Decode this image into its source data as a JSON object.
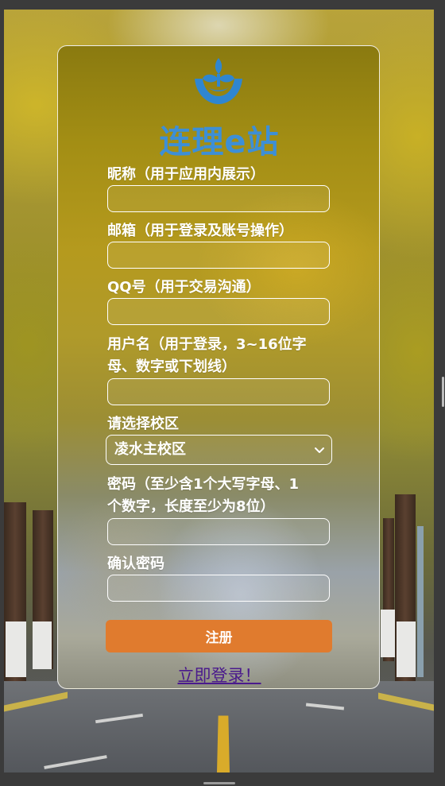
{
  "brand": {
    "name": "连理e站",
    "color": "#3d8fd6"
  },
  "form": {
    "nickname_label": "昵称（用于应用内展示）",
    "email_label": "邮箱（用于登录及账号操作）",
    "qq_label": "QQ号（用于交易沟通）",
    "username_label_line1": "用户名（用于登录，3~16位字",
    "username_label_line2": "母、数字或下划线）",
    "campus_label": "请选择校区",
    "campus_selected": "凌水主校区",
    "password_label_line1": "密码（至少含1个大写字母、1",
    "password_label_line2": "个数字，长度至少为8位）",
    "confirm_label": "确认密码",
    "nickname_value": "",
    "email_value": "",
    "qq_value": "",
    "username_value": "",
    "password_value": "",
    "confirm_value": ""
  },
  "actions": {
    "submit_label": "注册",
    "login_link": "立即登录！"
  },
  "colors": {
    "accent_button": "#e07b2e",
    "link": "#4a1a8c",
    "logo_blue": "#2f86d0"
  },
  "icons": {
    "logo": "sprout-hand-logo-icon",
    "select_arrow": "chevron-down-icon"
  }
}
